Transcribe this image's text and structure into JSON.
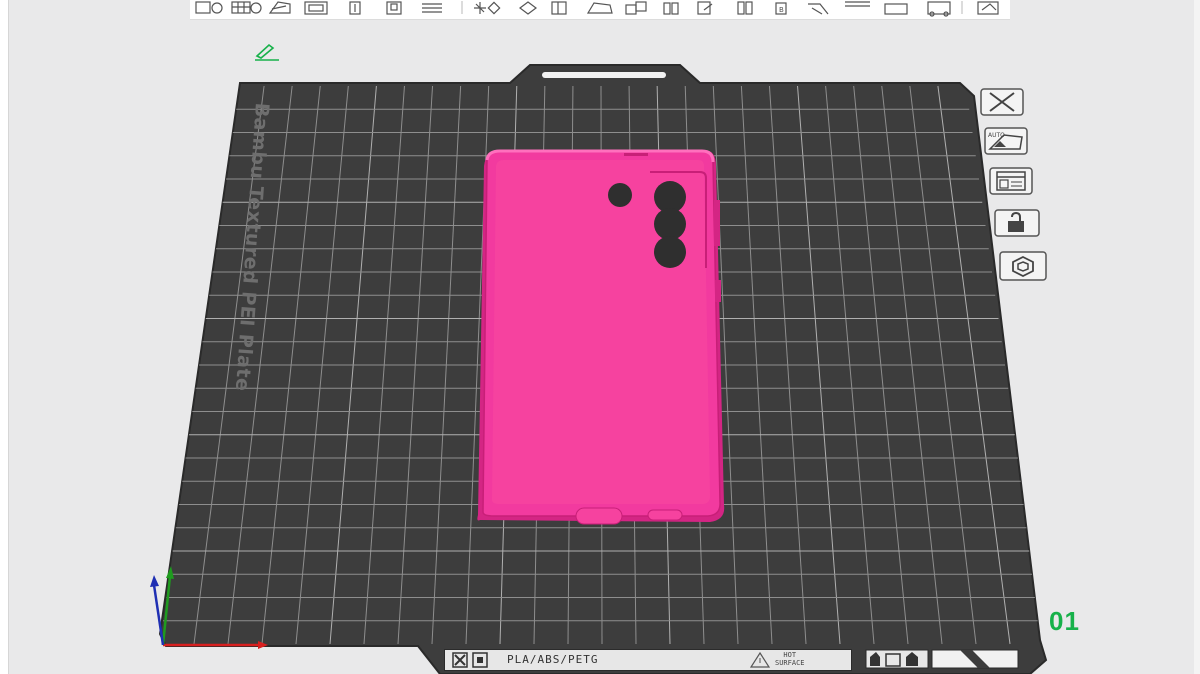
{
  "plate": {
    "label": "Bambu Textured PEI Plate",
    "number": "01",
    "filament_types": "PLA/ABS/PETG",
    "hot_surface_line1": "HOT",
    "hot_surface_line2": "SURFACE"
  },
  "colors": {
    "plate": "#3d3d3d",
    "grid": "#9a9a9a",
    "model": "#f23a9f",
    "accent": "#17b14a",
    "axis_x": "#d81f1f",
    "axis_y": "#1f9b1f",
    "axis_z": "#1f2fb3"
  },
  "toolbar": {
    "icons": [
      "add-part-icon",
      "add-plate-icon",
      "auto-orient-icon",
      "arrange-icon",
      "split-icon",
      "cut-icon",
      "layers-icon",
      "move-icon",
      "rotate-icon",
      "scale-icon",
      "support-paint-icon",
      "seam-paint-icon",
      "measure-icon",
      "assembly-icon",
      "text-icon",
      "color-paint-icon",
      "variable-layer-icon",
      "mesh-boolean-icon",
      "slice-view-icon"
    ]
  },
  "plate_controls": {
    "icons": [
      "delete-plate-icon",
      "auto-arrange-plate-icon",
      "plate-settings-icon",
      "lock-plate-icon",
      "slice-plate-icon"
    ]
  },
  "model": {
    "name": "phone-case"
  }
}
